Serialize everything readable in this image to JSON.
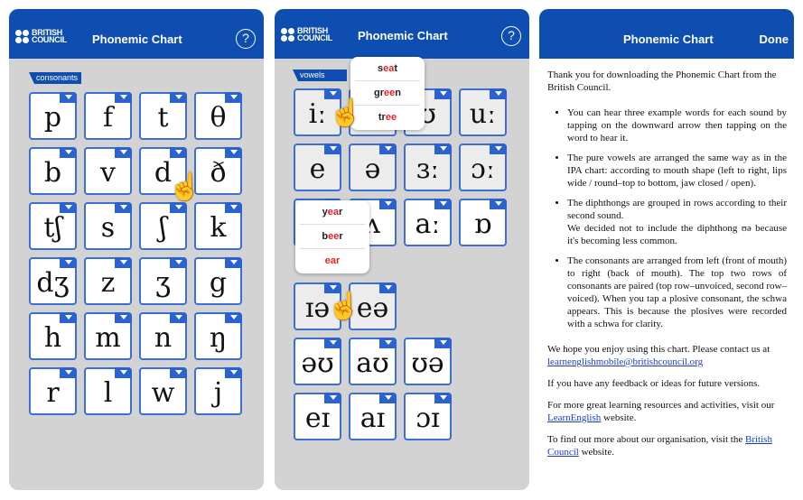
{
  "header": {
    "logo": "BRITISH COUNCIL",
    "title": "Phonemic Chart",
    "help": "?",
    "done": "Done"
  },
  "colors": {
    "brand": "#0e4eb0",
    "tile_border": "#3b6fd4",
    "highlight": "#e52222"
  },
  "consonants": {
    "label": "consonants",
    "symbols": [
      "p",
      "f",
      "t",
      "θ",
      "b",
      "v",
      "d",
      "ð",
      "tʃ",
      "s",
      "ʃ",
      "k",
      "dʒ",
      "z",
      "ʒ",
      "g",
      "h",
      "m",
      "n",
      "ŋ",
      "r",
      "l",
      "w",
      "j"
    ]
  },
  "vowels": {
    "label": "vowels",
    "rows": [
      [
        "iː",
        "",
        "ʊ",
        "uː"
      ],
      [
        "e",
        "ə",
        "ɜː",
        "ɔː"
      ],
      [
        "",
        "ʌ",
        "aː",
        "ɒ"
      ]
    ]
  },
  "diphthongs": {
    "rows": [
      [
        "ɪə",
        "eə"
      ],
      [
        "əʊ",
        "aʊ",
        "ʊə"
      ],
      [
        "eɪ",
        "aɪ",
        "ɔɪ"
      ]
    ]
  },
  "popup1": [
    {
      "pre": "s",
      "hl": "ea",
      "post": "t"
    },
    {
      "pre": "gr",
      "hl": "ee",
      "post": "n"
    },
    {
      "pre": "tr",
      "hl": "ee",
      "post": ""
    }
  ],
  "popup2": [
    {
      "pre": "y",
      "hl": "ea",
      "post": "r"
    },
    {
      "pre": "b",
      "hl": "ee",
      "post": "r"
    },
    {
      "pre": "",
      "hl": "ear",
      "post": ""
    }
  ],
  "about": {
    "intro": "Thank you for downloading the Phonemic Chart from the British Council.",
    "bullets": [
      "You can hear three example words for each sound by tapping on the downward arrow then tapping on the word to hear it.",
      "The pure vowels are arranged the same way as in the IPA chart: according to mouth shape (left to right, lips wide / round–top to bottom, jaw closed / open).",
      "The diphthongs are grouped in rows according to their second sound.",
      "The consonants are arranged from left (front of mouth) to right (back of mouth). The top two rows of consonants are paired (top row–unvoiced, second row–voiced). When you tap a plosive consonant, the schwa appears. This is because the plosives were recorded with a schwa for clarity."
    ],
    "bullet3_extra": "We decided not to include the diphthong ʊə because it's becoming less common.",
    "contact": "We hope you enjoy using this chart. Please contact us at",
    "email": "learnenglishmobile@britishcouncil.org",
    "feedback": "If you have any feedback or ideas for future versions.",
    "more_pre": "For more great learning resources and activities, visit our",
    "more_link": "LearnEnglish",
    "more_post": "website.",
    "org_pre": "To find out more about our organisation, visit the",
    "org_link": "British Council",
    "org_post": "website."
  }
}
